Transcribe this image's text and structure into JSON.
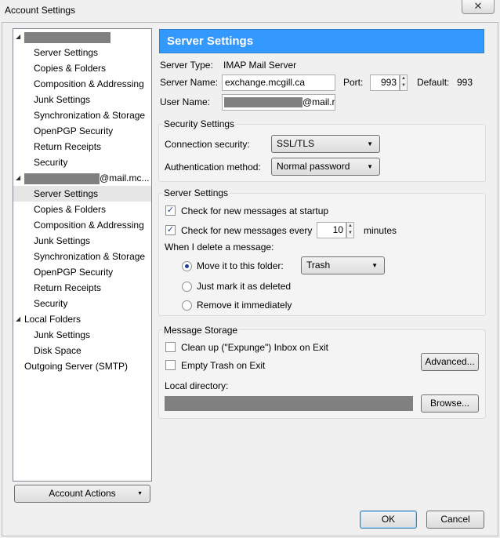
{
  "window": {
    "title": "Account Settings",
    "close_glyph": "✕"
  },
  "tree": {
    "account1": {
      "name_suffix": "",
      "children": [
        "Server Settings",
        "Copies & Folders",
        "Composition & Addressing",
        "Junk Settings",
        "Synchronization & Storage",
        "OpenPGP Security",
        "Return Receipts",
        "Security"
      ]
    },
    "account2": {
      "name_suffix": "@mail.mc...",
      "children": [
        "Server Settings",
        "Copies & Folders",
        "Composition & Addressing",
        "Junk Settings",
        "Synchronization & Storage",
        "OpenPGP Security",
        "Return Receipts",
        "Security"
      ]
    },
    "local_folders": {
      "name": "Local Folders",
      "children": [
        "Junk Settings",
        "Disk Space"
      ]
    },
    "outgoing_server": "Outgoing Server (SMTP)",
    "selected": "account2.Server Settings"
  },
  "account_actions": "Account Actions",
  "header": {
    "title": "Server Settings"
  },
  "server": {
    "type_label": "Server Type:",
    "type_value": "IMAP Mail Server",
    "name_label": "Server Name:",
    "name_value": "exchange.mcgill.ca",
    "port_label": "Port:",
    "port_value": "993",
    "default_label": "Default:",
    "default_value": "993",
    "user_label": "User Name:",
    "user_suffix": "@mail.r"
  },
  "security": {
    "title": "Security Settings",
    "connection_label": "Connection security:",
    "connection_value": "SSL/TLS",
    "auth_label": "Authentication method:",
    "auth_value": "Normal password"
  },
  "server_settings_group": {
    "title": "Server Settings",
    "check_startup": "Check for new messages at startup",
    "check_startup_checked": true,
    "check_every": "Check for new messages every",
    "check_every_checked": true,
    "interval": "10",
    "minutes": "minutes",
    "delete_label": "When I delete a message:",
    "move_label": "Move it to this folder:",
    "move_selected": true,
    "folder_value": "Trash",
    "mark_label": "Just mark it as deleted",
    "remove_label": "Remove it immediately"
  },
  "storage": {
    "title": "Message Storage",
    "cleanup_label": "Clean up (\"Expunge\") Inbox on Exit",
    "cleanup_checked": false,
    "empty_trash_label": "Empty Trash on Exit",
    "empty_trash_checked": false,
    "advanced_button": "Advanced...",
    "local_dir_label": "Local directory:",
    "browse_button": "Browse..."
  },
  "footer": {
    "ok": "OK",
    "cancel": "Cancel"
  },
  "icons": {
    "expand": "expanded-triangle-icon",
    "dropdown": "chevron-down-icon",
    "spin": "spinner-arrows-icon"
  }
}
